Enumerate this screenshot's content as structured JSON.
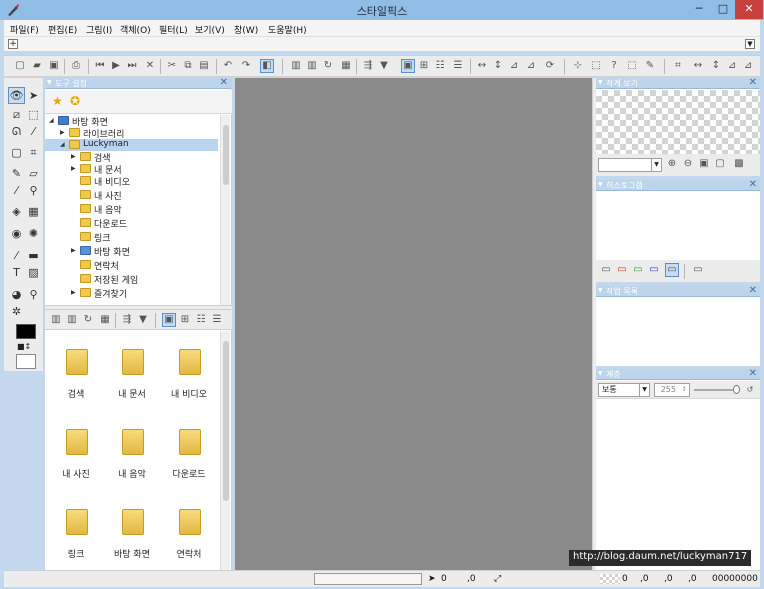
{
  "window": {
    "title": "스타일픽스",
    "minimize": "─",
    "maximize": "□",
    "close": "✕"
  },
  "menu": [
    "파일(F)",
    "편집(E)",
    "그림(I)",
    "객체(O)",
    "필터(L)",
    "보기(V)",
    "창(W)",
    "도움말(H)"
  ],
  "tabstrip": {
    "add": "+",
    "chevron": "▼",
    "menu_chevron": "▼"
  },
  "tool_panel": {
    "title": "도구 설정",
    "tree": [
      {
        "label": "바탕 화면",
        "level": 0,
        "expanded": true
      },
      {
        "label": "라이브러리",
        "level": 1,
        "expanded": false
      },
      {
        "label": "Luckyman",
        "level": 1,
        "expanded": true,
        "selected": true
      },
      {
        "label": "검색",
        "level": 2,
        "expanded": false
      },
      {
        "label": "내 문서",
        "level": 2,
        "expanded": false
      },
      {
        "label": "내 비디오",
        "level": 2
      },
      {
        "label": "내 사진",
        "level": 2
      },
      {
        "label": "내 음악",
        "level": 2
      },
      {
        "label": "다운로드",
        "level": 2
      },
      {
        "label": "링크",
        "level": 2
      },
      {
        "label": "바탕 화면",
        "level": 2,
        "expanded": false
      },
      {
        "label": "연락처",
        "level": 2
      },
      {
        "label": "저장된 게임",
        "level": 2
      },
      {
        "label": "즐겨찾기",
        "level": 2,
        "expanded": false
      }
    ],
    "thumbnails": [
      "검색",
      "내 문서",
      "내 비디오",
      "내 사진",
      "내 음악",
      "다운로드",
      "링크",
      "바탕 화면",
      "연락처"
    ]
  },
  "right_panels": {
    "navigator": {
      "title": "작게 보기"
    },
    "histogram": {
      "title": "히스토그램"
    },
    "history": {
      "title": "작업 목록"
    },
    "layers": {
      "title": "계층",
      "blend_mode": "보통",
      "opacity": "255"
    }
  },
  "statusbar": {
    "cursor_x": "0",
    "cursor_y": ",0",
    "sel_x": ",0",
    "sel_y": ",0",
    "sel_w": "0",
    "sel_h": ",0",
    "color": "00000000"
  },
  "watermark": "http://blog.daum.net/luckyman717",
  "colors": {
    "titlebar": "#8fbde6",
    "close_button": "#c7403d",
    "panel_header": "#bcd4ec",
    "canvas": "#8a8a8a",
    "selection": "#b8d4ee"
  }
}
